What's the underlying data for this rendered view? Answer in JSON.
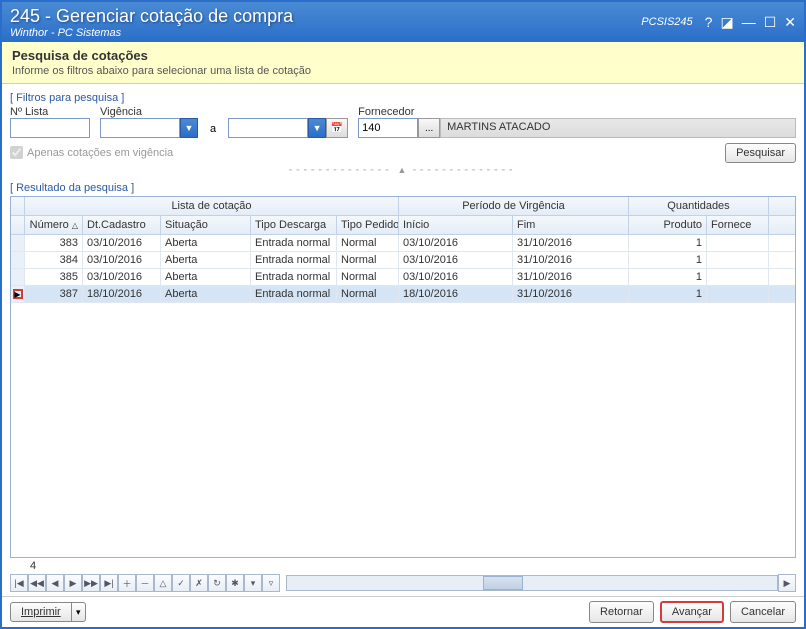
{
  "window": {
    "title": "245 - Gerenciar cotação de compra",
    "subtitle": "Winthor - PC Sistemas",
    "app_id": "PCSIS245"
  },
  "banner": {
    "heading": "Pesquisa de cotações",
    "subtext": "Informe os filtros abaixo para selecionar uma lista de cotação"
  },
  "labels": {
    "filter_group": "[ Filtros para pesquisa ]",
    "n_lista": "Nº Lista",
    "vigencia": "Vigência",
    "a": "a",
    "fornecedor": "Fornecedor",
    "only_active": "Apenas cotações em vigência",
    "result_group": "[ Resultado da pesquisa ]",
    "pesquisar": "Pesquisar",
    "imprimir": "Imprimir",
    "retornar": "Retornar",
    "avancar": "Avançar",
    "cancelar": "Cancelar"
  },
  "filters": {
    "n_lista": "",
    "vigencia_from": "",
    "vigencia_to": "",
    "fornecedor_code": "140",
    "fornecedor_name": "MARTINS ATACADO",
    "only_active_checked": true
  },
  "grid": {
    "group_lista": "Lista de cotação",
    "group_periodo": "Período de Virgência",
    "group_qtd": "Quantidades",
    "cols": {
      "numero": "Número",
      "dt_cadastro": "Dt.Cadastro",
      "situacao": "Situação",
      "tipo_descarga": "Tipo Descarga",
      "tipo_pedido": "Tipo Pedido",
      "inicio": "Início",
      "fim": "Fim",
      "produto": "Produto",
      "fornecedor": "Fornece"
    },
    "rows": [
      {
        "numero": "383",
        "dt": "03/10/2016",
        "sit": "Aberta",
        "desc": "Entrada normal",
        "ped": "Normal",
        "ini": "03/10/2016",
        "fim": "31/10/2016",
        "prod": "1",
        "forn": ""
      },
      {
        "numero": "384",
        "dt": "03/10/2016",
        "sit": "Aberta",
        "desc": "Entrada normal",
        "ped": "Normal",
        "ini": "03/10/2016",
        "fim": "31/10/2016",
        "prod": "1",
        "forn": ""
      },
      {
        "numero": "385",
        "dt": "03/10/2016",
        "sit": "Aberta",
        "desc": "Entrada normal",
        "ped": "Normal",
        "ini": "03/10/2016",
        "fim": "31/10/2016",
        "prod": "1",
        "forn": ""
      },
      {
        "numero": "387",
        "dt": "18/10/2016",
        "sit": "Aberta",
        "desc": "Entrada normal",
        "ped": "Normal",
        "ini": "18/10/2016",
        "fim": "31/10/2016",
        "prod": "1",
        "forn": ""
      }
    ],
    "selected_index": 3,
    "record_count": "4"
  },
  "nav_icons": [
    "|◀",
    "◀◀",
    "◀",
    "▶",
    "▶▶",
    "▶|",
    "＋",
    "－",
    "△",
    "✓",
    "✗",
    "↻",
    "✱",
    "▾",
    "▿"
  ]
}
